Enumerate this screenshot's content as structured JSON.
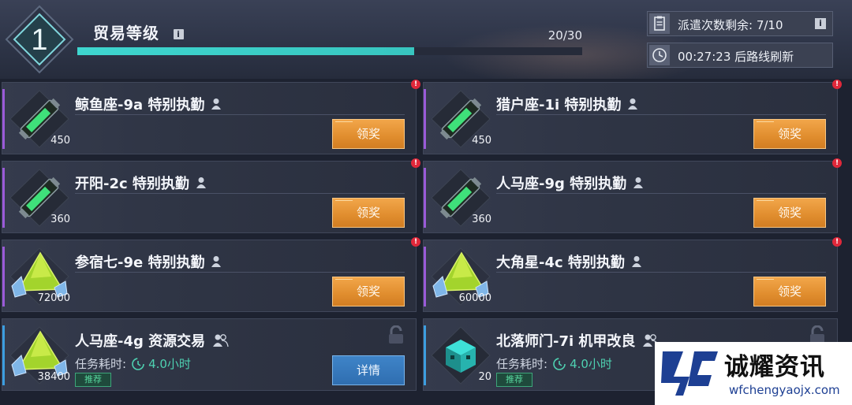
{
  "header": {
    "level": "1",
    "title": "贸易等级",
    "info_icon": "i",
    "xp": "20/30",
    "xp_progress": 0.667,
    "dispatch_label": "派遣次数剩余: 7/10",
    "refresh_label": "00:27:23 后路线刷新",
    "accent_color": "#3ed6cf"
  },
  "missions": [
    {
      "title": "鲸鱼座-9a 特别执勤",
      "count": "450",
      "item": "green-tube",
      "button": "领奖",
      "alert": "!"
    },
    {
      "title": "猎户座-1i 特别执勤",
      "count": "450",
      "item": "green-tube",
      "button": "领奖",
      "alert": "!"
    },
    {
      "title": "开阳-2c 特别执勤",
      "count": "360",
      "item": "green-tube",
      "button": "领奖",
      "alert": "!"
    },
    {
      "title": "人马座-9g 特别执勤",
      "count": "360",
      "item": "green-tube",
      "button": "领奖",
      "alert": "!"
    },
    {
      "title": "参宿七-9e 特别执勤",
      "count": "72000",
      "item": "green-crystal",
      "button": "领奖",
      "alert": "!"
    },
    {
      "title": "大角星-4c 特别执勤",
      "count": "60000",
      "item": "green-crystal",
      "button": "领奖",
      "alert": "!"
    },
    {
      "title": "人马座-4g 资源交易",
      "count": "38400",
      "item": "green-crystal",
      "button": "详情",
      "time_label": "任务耗时:",
      "time_value": "4.0小时",
      "tag": "推荐"
    },
    {
      "title": "北落师门-7i 机甲改良",
      "count": "20",
      "item": "teal-cube",
      "time_label": "任务耗时:",
      "time_value": "4.0小时",
      "tag": "推荐"
    }
  ],
  "watermark": {
    "title": "诚耀资讯",
    "url": "wfchengyaojx.com"
  }
}
